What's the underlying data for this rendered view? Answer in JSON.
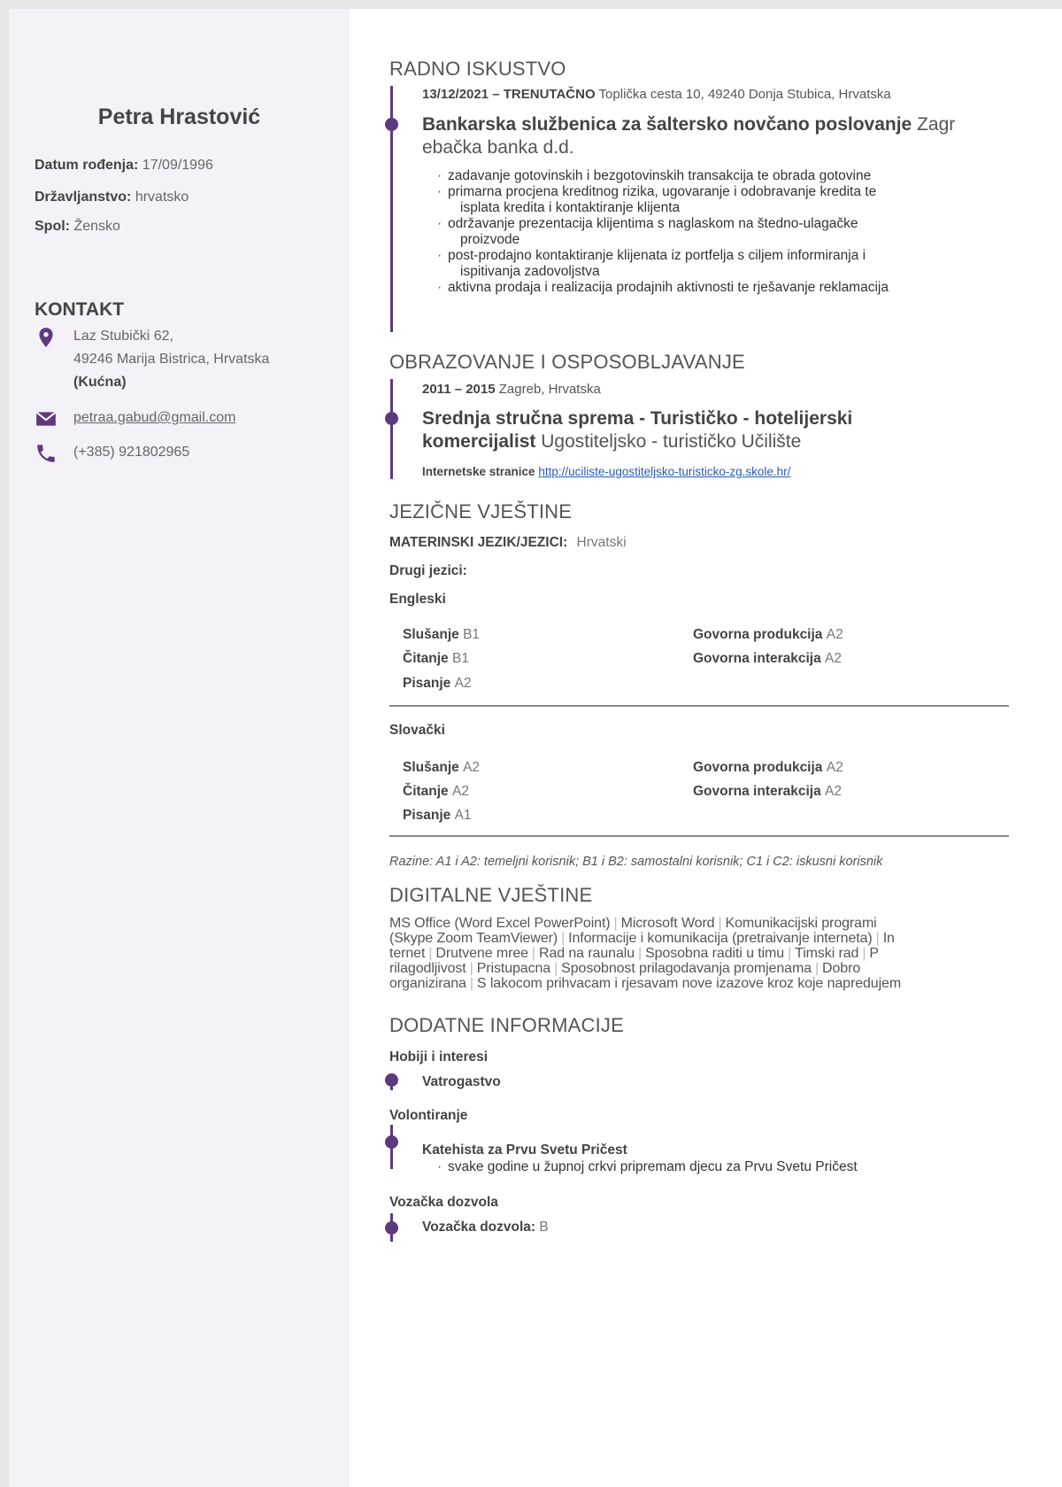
{
  "person": {
    "name": "Petra Hrastović",
    "dob_label": "Datum rođenja:",
    "dob_value": "17/09/1996",
    "citizenship_label": "Državljanstvo:",
    "citizenship_value": "hrvatsko",
    "gender_label": "Spol:",
    "gender_value": "Žensko"
  },
  "contact": {
    "heading": "KONTAKT",
    "address_line1": "Laz Stubički 62,",
    "address_line2": "49246 Marija Bistrica, Hrvatska",
    "address_type": "(Kućna)",
    "email": "petraa.gabud@gmail.com",
    "phone": "(+385) 921802965",
    "icons": [
      "location-pin-icon",
      "envelope-icon",
      "phone-icon"
    ],
    "accent_color": "#5d3a7e"
  },
  "experience": {
    "heading": "RADNO ISKUSTVO",
    "date": "13/12/2021 – TRENUTAČNO",
    "location": "Toplička cesta 10, 49240 Donja Stubica, Hrvatska",
    "title": "Bankarska službenica za šaltersko novčano poslovanje",
    "employer_line1": "Zagr",
    "employer_line2": "ebačka banka d.d.",
    "duties": [
      [
        "zadavanje gotovinskih i bezgotovinskih transakcija te obrada gotovine"
      ],
      [
        "primarna procjena kreditnog rizika, ugovaranje i odobravanje kredita te",
        "isplata kredita i kontaktiranje klijenta"
      ],
      [
        "održavanje prezentacija klijentima s naglaskom na štedno-ulagačke",
        "proizvode"
      ],
      [
        "post-prodajno kontaktiranje klijenata iz portfelja s ciljem informiranja i",
        "ispitivanja zadovoljstva"
      ],
      [
        "aktivna prodaja i realizacija prodajnih aktivnosti te rješavanje reklamacija"
      ]
    ]
  },
  "education": {
    "heading": "OBRAZOVANJE I OSPOSOBLJAVANJE",
    "date": "2011 – 2015",
    "location": "Zagreb, Hrvatska",
    "title_line1": "Srednja stručna sprema - Turističko - hotelijerski",
    "title_line2": "komercijalist",
    "school": "Ugostiteljsko - turističko Učilište",
    "web_label": "Internetske stranice",
    "web_url": "http://uciliste-ugostiteljsko-turisticko-zg.skole.hr/"
  },
  "languages": {
    "heading": "JEZIČNE VJEŠTINE",
    "mother_label": "MATERINSKI JEZIK/JEZICI:",
    "mother_value": "Hrvatski",
    "other_label": "Drugi jezici:",
    "list": [
      {
        "name": "Engleski",
        "slusanje": "B1",
        "citanje": "B1",
        "pisanje": "A2",
        "produkcija": "A2",
        "interakcija": "A2"
      },
      {
        "name": "Slovački",
        "slusanje": "A2",
        "citanje": "A2",
        "pisanje": "A1",
        "produkcija": "A2",
        "interakcija": "A2"
      }
    ],
    "labels": {
      "slusanje": "Slušanje",
      "citanje": "Čitanje",
      "pisanje": "Pisanje",
      "produkcija": "Govorna produkcija",
      "interakcija": "Govorna interakcija"
    },
    "levels_note": "Razine: A1 i A2: temeljni korisnik; B1 i B2: samostalni korisnik; C1 i C2: iskusni korisnik"
  },
  "digital": {
    "heading": "DIGITALNE VJEŠTINE",
    "lines": [
      [
        "MS Office (Word Excel PowerPoint)",
        "Microsoft Word",
        "Komunikacijski programi"
      ],
      [
        "(Skype Zoom TeamViewer)",
        "Informacije i komunikacija (pretraivanje interneta)",
        "In"
      ],
      [
        "ternet",
        "Drutvene mree",
        "Rad na raunalu",
        "Sposobna raditi u timu",
        "Timski rad",
        "P"
      ],
      [
        "rilagodljivost",
        "Pristupacna",
        "Sposobnost prilagodavanja promjenama",
        "Dobro"
      ],
      [
        "organizirana",
        "S lakocom prihvacam i rjesavam nove izazove kroz koje napredujem"
      ]
    ]
  },
  "additional": {
    "heading": "DODATNE INFORMACIJE",
    "hobbies_label": "Hobiji i interesi",
    "hobby": "Vatrogastvo",
    "volunteer_label": "Volontiranje",
    "volunteer_title": "Katehista za Prvu Svetu Pričest",
    "volunteer_desc": "svake godine u župnoj crkvi pripremam djecu za Prvu Svetu Pričest",
    "license_section_label": "Vozačka dozvola",
    "license_label": "Vozačka dozvola:",
    "license_value": "B"
  }
}
